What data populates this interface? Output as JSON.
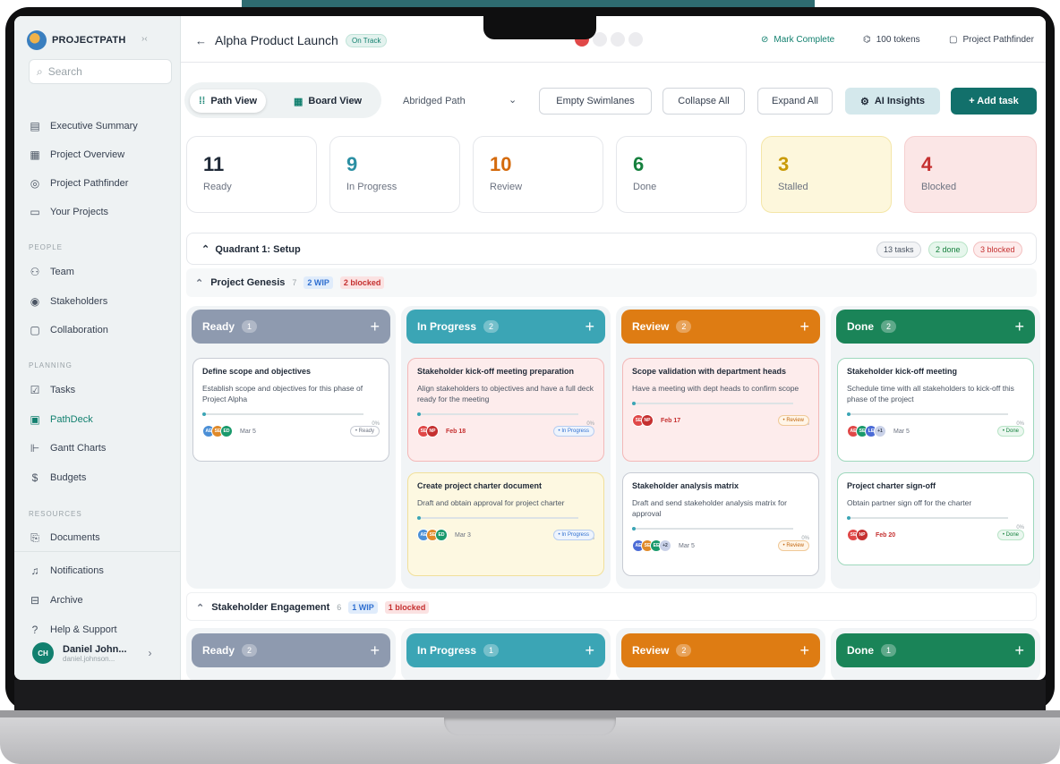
{
  "sidebar": {
    "brand": "PROJECTPATH",
    "search_placeholder": "Search",
    "items_main": [
      {
        "label": "Executive Summary",
        "icon": "clipboard-icon"
      },
      {
        "label": "Project Overview",
        "icon": "grid-icon"
      },
      {
        "label": "Project Pathfinder",
        "icon": "compass-icon"
      },
      {
        "label": "Your Projects",
        "icon": "monitor-icon"
      }
    ],
    "section_people": "PEOPLE",
    "items_people": [
      {
        "label": "Team",
        "icon": "users-icon"
      },
      {
        "label": "Stakeholders",
        "icon": "stakeholder-icon"
      },
      {
        "label": "Collaboration",
        "icon": "chat-icon"
      }
    ],
    "section_planning": "PLANNING",
    "items_planning": [
      {
        "label": "Tasks",
        "icon": "checkbox-icon"
      },
      {
        "label": "PathDeck",
        "icon": "deck-icon"
      },
      {
        "label": "Gantt Charts",
        "icon": "gantt-icon"
      },
      {
        "label": "Budgets",
        "icon": "dollar-icon"
      }
    ],
    "section_resources": "RESOURCES",
    "items_resources": [
      {
        "label": "Documents",
        "icon": "document-icon"
      }
    ],
    "items_bottom": [
      {
        "label": "Notifications",
        "icon": "bell-icon"
      },
      {
        "label": "Archive",
        "icon": "archive-icon"
      },
      {
        "label": "Help & Support",
        "icon": "help-icon"
      }
    ],
    "user": {
      "initials": "CH",
      "name": "Daniel John...",
      "email": "daniel.johnson..."
    }
  },
  "topbar": {
    "title": "Alpha Product Launch",
    "status": "On Track",
    "mark_complete": "Mark Complete",
    "tokens": "100 tokens",
    "pathfinder": "Project Pathfinder"
  },
  "toolbar": {
    "tab_path": "Path View",
    "tab_board": "Board View",
    "abridged": "Abridged Path",
    "empty_swimlanes": "Empty Swimlanes",
    "collapse_all": "Collapse All",
    "expand_all": "Expand All",
    "ai_insights": "AI Insights",
    "add_task": "+ Add task"
  },
  "stats": [
    {
      "value": "11",
      "label": "Ready",
      "color": "#1f2937"
    },
    {
      "value": "9",
      "label": "In Progress",
      "color": "#2b8fa3"
    },
    {
      "value": "10",
      "label": "Review",
      "color": "#d46a0c"
    },
    {
      "value": "6",
      "label": "Done",
      "color": "#15803d"
    },
    {
      "value": "3",
      "label": "Stalled",
      "color": "#c99a06"
    },
    {
      "value": "4",
      "label": "Blocked",
      "color": "#c53030"
    }
  ],
  "quadrant": {
    "title": "Quadrant 1: Setup",
    "tasks": "13 tasks",
    "done": "2 done",
    "blocked": "3 blocked"
  },
  "project1": {
    "title": "Project Genesis",
    "count": "7",
    "wip": "2 WIP",
    "blocked": "2 blocked"
  },
  "project2": {
    "title": "Stakeholder Engagement",
    "count": "6",
    "wip": "1 WIP",
    "blocked": "1 blocked"
  },
  "columns1": [
    {
      "title": "Ready",
      "count": "1"
    },
    {
      "title": "In Progress",
      "count": "2"
    },
    {
      "title": "Review",
      "count": "2"
    },
    {
      "title": "Done",
      "count": "2"
    }
  ],
  "columns2": [
    {
      "title": "Ready",
      "count": "2"
    },
    {
      "title": "In Progress",
      "count": "1"
    },
    {
      "title": "Review",
      "count": "2"
    },
    {
      "title": "Done",
      "count": "1"
    }
  ],
  "cards": [
    {
      "title": "Define scope and objectives",
      "desc": "Establish scope and objectives for this phase of Project Alpha",
      "pct": "0%",
      "date": "Mar 5",
      "status": "• Ready",
      "avatars": [
        "AE",
        "SE",
        "ED"
      ]
    },
    {
      "title": "Stakeholder kick-off meeting preparation",
      "desc": "Align stakeholders to objectives and have a full deck ready for the meeting",
      "pct": "0%",
      "date": "Feb 18",
      "status": "• In Progress",
      "avatars": [
        "SE",
        "NP"
      ]
    },
    {
      "title": "Scope validation with department heads",
      "desc": "Have a meeting with dept heads to confirm scope",
      "pct": "0%",
      "date": "Feb 17",
      "status": "• Review",
      "avatars": [
        "SE",
        "NP"
      ]
    },
    {
      "title": "Stakeholder kick-off meeting",
      "desc": "Schedule time with all stakeholders to kick-off this phase of the project",
      "pct": "0%",
      "date": "Mar 5",
      "status": "• Done",
      "avatars": [
        "AE",
        "SE",
        "LE"
      ],
      "extra": "+1"
    },
    {
      "title": "Create project charter document",
      "desc": "Draft and obtain approval for project charter",
      "pct": "0%",
      "date": "Mar 3",
      "status": "• In Progress",
      "avatars": [
        "AE",
        "SE",
        "ED"
      ]
    },
    {
      "title": "Stakeholder analysis matrix",
      "desc": "Draft and send stakeholder analysis matrix for approval",
      "pct": "0%",
      "date": "Mar 5",
      "status": "• Review",
      "avatars": [
        "AE",
        "SE",
        "EE"
      ],
      "extra": "+2"
    },
    {
      "title": "Project charter sign-off",
      "desc": "Obtain partner sign off for the charter",
      "pct": "0%",
      "date": "Feb 20",
      "status": "• Done",
      "avatars": [
        "SE",
        "NP"
      ]
    }
  ]
}
